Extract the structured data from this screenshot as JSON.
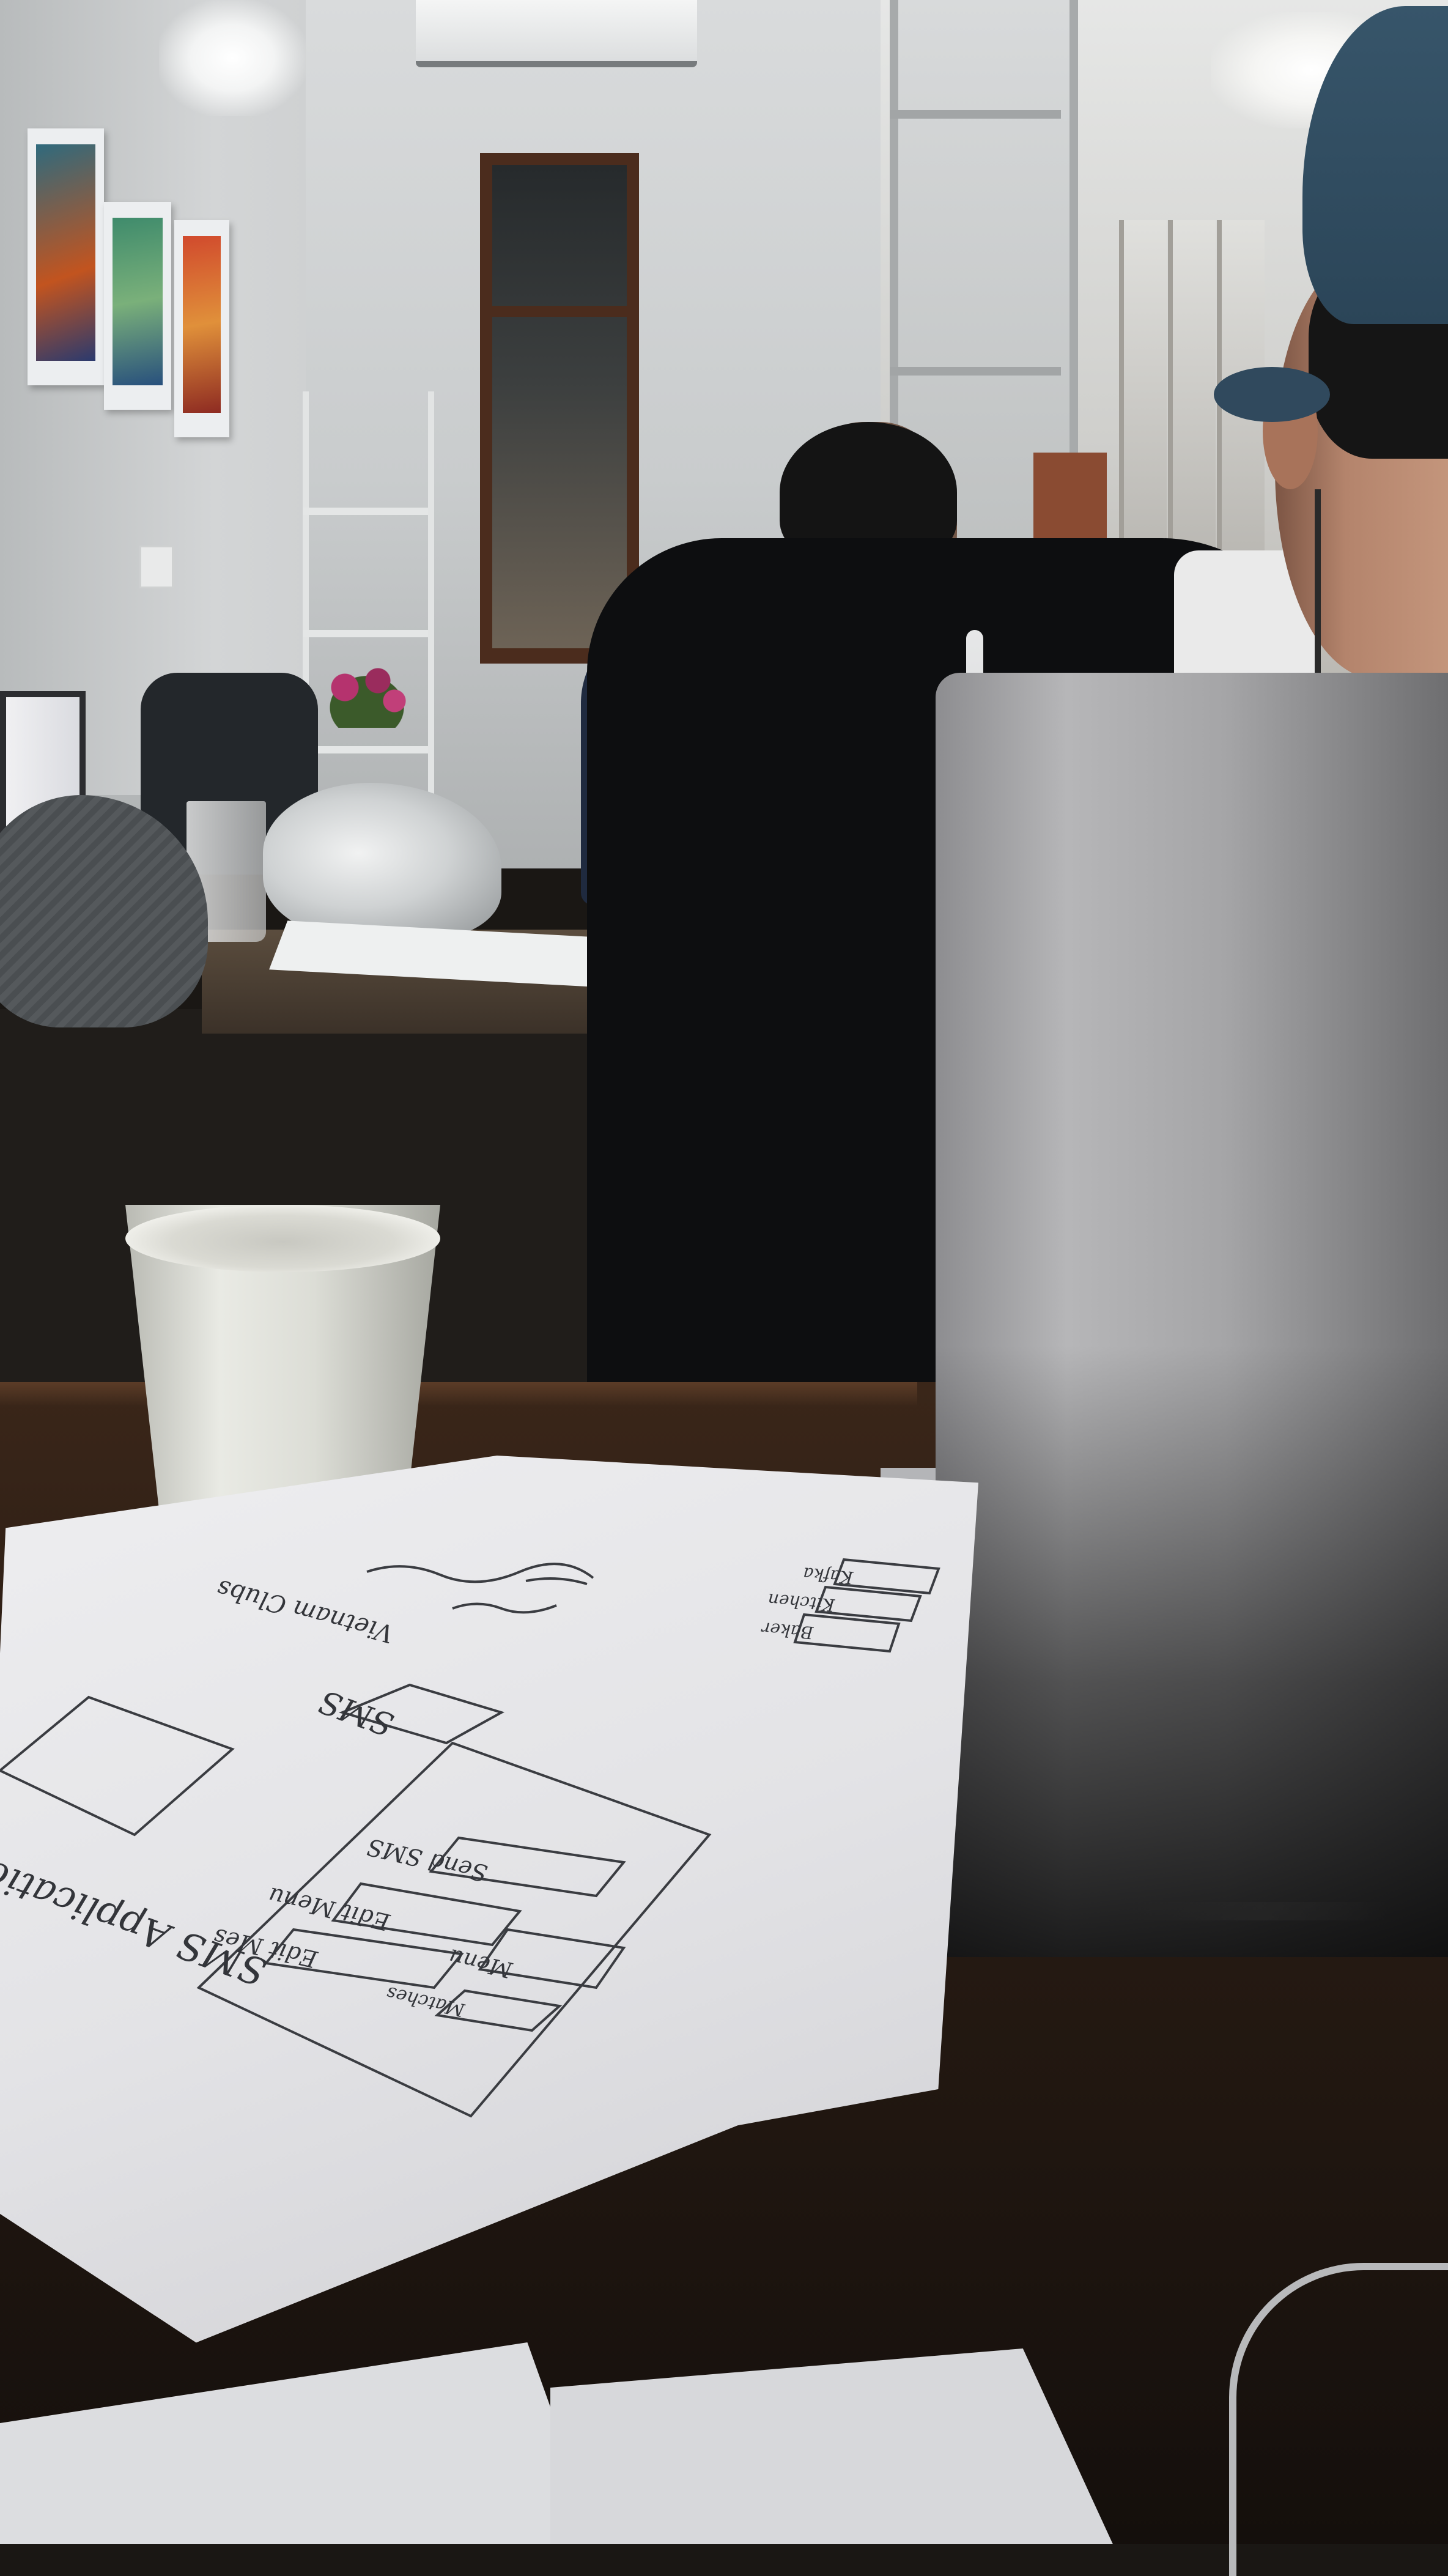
{
  "scene": {
    "type": "photo",
    "setting": "office"
  },
  "sketch": {
    "main_title": "SMS Applications",
    "header_label": "SMS",
    "buttons": [
      "Send SMS",
      "Edit Menu",
      "Menu",
      "Edit Mes",
      "Matches"
    ],
    "top_right_boxes": [
      "Kafka",
      "Kitchen",
      "Baker"
    ],
    "scribble_note": "Vietnam Clubs",
    "colors": {
      "ink": "#33353a",
      "paper": "#e6e6e9"
    }
  }
}
